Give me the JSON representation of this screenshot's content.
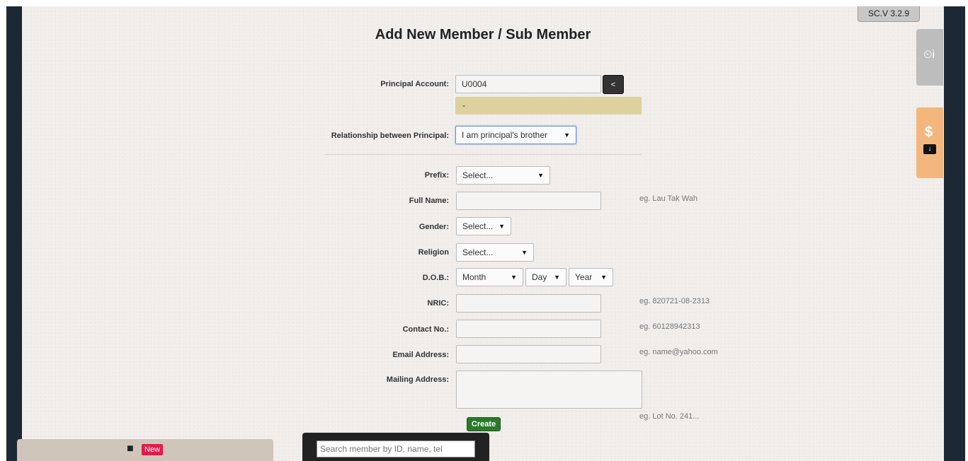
{
  "version": "SC.V 3.2.9",
  "page_title": "Add New Member / Sub Member",
  "principal": {
    "label": "Principal Account:",
    "value": "U0004",
    "back_label": "<",
    "notice": "-"
  },
  "relationship": {
    "label": "Relationship between Principal:",
    "selected": "I am principal's brother"
  },
  "form": {
    "prefix": {
      "label": "Prefix:",
      "selected": "Select..."
    },
    "full_name": {
      "label": "Full Name:",
      "value": "",
      "hint": "eg. Lau Tak Wah"
    },
    "gender": {
      "label": "Gender:",
      "selected": "Select..."
    },
    "religion": {
      "label": "Religion",
      "selected": "Select..."
    },
    "dob": {
      "label": "D.O.B.:",
      "month": "Month",
      "day": "Day",
      "year": "Year"
    },
    "nric": {
      "label": "NRIC:",
      "value": "",
      "hint": "eg. 820721-08-2313"
    },
    "contact": {
      "label": "Contact No.:",
      "value": "",
      "hint": "eg. 60128942313"
    },
    "email": {
      "label": "Email Address:",
      "value": "",
      "hint": "eg. name@yahoo.com"
    },
    "mailing": {
      "label": "Mailing Address:",
      "value": "",
      "hint": "eg. Lot No. 241..."
    },
    "create_label": "Create"
  },
  "side_tabs": {
    "history_icon": "clock-info-icon",
    "cash_icon": "dollar-download-icon"
  },
  "bottom": {
    "new_badge": "New",
    "search_placeholder": "Search member by ID, name, tel"
  }
}
